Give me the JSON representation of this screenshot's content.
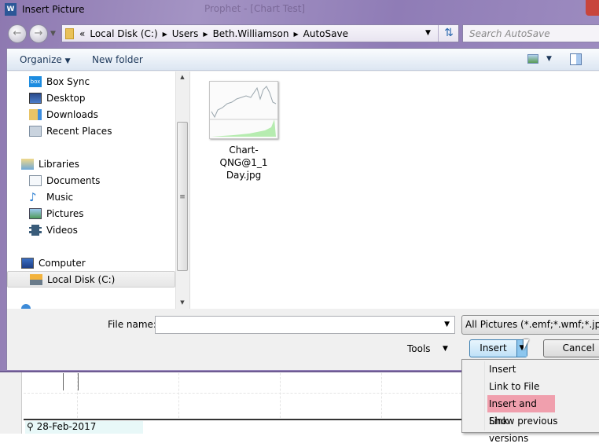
{
  "window": {
    "title": "Insert Picture",
    "background_title": "Prophet - [Chart Test]"
  },
  "address": {
    "crumbs": [
      "Local Disk (C:)",
      "Users",
      "Beth.Williamson",
      "AutoSave"
    ],
    "overflow": "«"
  },
  "search": {
    "placeholder": "Search AutoSave"
  },
  "toolbar": {
    "organize": "Organize",
    "new_folder": "New folder"
  },
  "nav": {
    "favorites": [
      {
        "label": "Box Sync",
        "icon": "box-icon"
      },
      {
        "label": "Desktop",
        "icon": "desktop-icon"
      },
      {
        "label": "Downloads",
        "icon": "downloads-icon"
      },
      {
        "label": "Recent Places",
        "icon": "recent-places-icon"
      }
    ],
    "libraries": {
      "label": "Libraries",
      "items": [
        {
          "label": "Documents",
          "icon": "documents-icon"
        },
        {
          "label": "Music",
          "icon": "music-icon"
        },
        {
          "label": "Pictures",
          "icon": "pictures-icon"
        },
        {
          "label": "Videos",
          "icon": "videos-icon"
        }
      ]
    },
    "computer": {
      "label": "Computer",
      "items": [
        {
          "label": "Local Disk (C:)",
          "selected": true
        }
      ]
    }
  },
  "files": [
    {
      "name": "Chart-QNG@1_1 Day.jpg",
      "name_line1": "Chart-QNG@1_1",
      "name_line2": "Day.jpg"
    }
  ],
  "bottom": {
    "file_name_label": "File name:",
    "file_name_value": "",
    "filter": "All Pictures (*.emf;*.wmf;*.jpg;*",
    "tools": "Tools",
    "insert": "Insert",
    "cancel": "Cancel"
  },
  "insert_menu": {
    "items": [
      "Insert",
      "Link to File",
      "Insert and Link",
      "Show previous versions"
    ],
    "highlighted": "Insert and Link",
    "highlight_color": "#f09fad"
  },
  "background_chart": {
    "date": "28-Feb-2017"
  }
}
